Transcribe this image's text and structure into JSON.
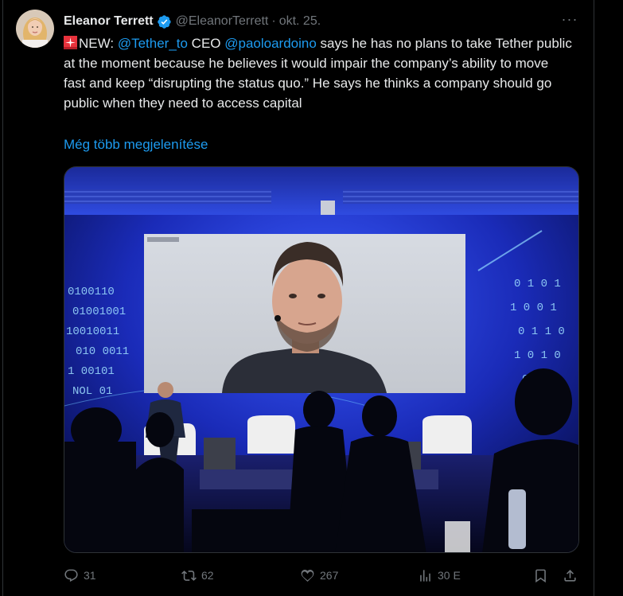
{
  "author": {
    "name": "Eleanor Terrett",
    "handle": "@EleanorTerrett",
    "separator": "·",
    "date": "okt. 25."
  },
  "tweet": {
    "prefix": "NEW: ",
    "mention1": "@Tether_to",
    "mid1": " CEO ",
    "mention2": "@paoloardoino",
    "body": " says he has no plans to take Tether public at the moment because he believes it would impair the company’s ability to move fast and keep “disrupting the status quo.” He says he thinks a company should go public when they need to access capital",
    "show_more": "Még több megjelenítése"
  },
  "actions": {
    "replies": "31",
    "reposts": "62",
    "likes": "267",
    "views": "30 E"
  },
  "colors": {
    "accent": "#1d9bf0",
    "muted": "#71767b",
    "text": "#e7e9ea",
    "background": "#000000",
    "border": "#2f3336"
  },
  "icons": [
    "verified-badge-icon",
    "siren-emoji-icon",
    "more-options-icon",
    "reply-icon",
    "repost-icon",
    "like-icon",
    "views-icon",
    "bookmark-icon",
    "share-icon"
  ]
}
